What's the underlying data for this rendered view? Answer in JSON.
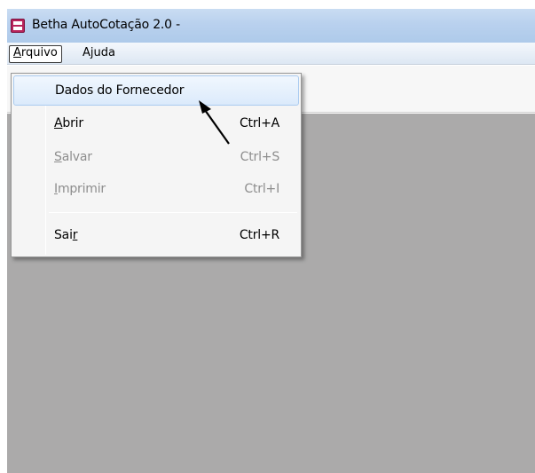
{
  "window": {
    "title": "Betha AutoCotação 2.0 -"
  },
  "menubar": {
    "arquivo": {
      "first": "A",
      "rest": "rquivo"
    },
    "ajuda": "Ajuda"
  },
  "dropdown": {
    "dados": {
      "label": "Dados do Fornecedor"
    },
    "abrir": {
      "first": "A",
      "rest": "brir",
      "shortcut": "Ctrl+A"
    },
    "salvar": {
      "first": "S",
      "rest": "alvar",
      "shortcut": "Ctrl+S"
    },
    "imprimir": {
      "first": "I",
      "rest": "mprimir",
      "shortcut": "Ctrl+I"
    },
    "sair": {
      "pre": "Sai",
      "mnemonic": "r",
      "shortcut": "Ctrl+R"
    }
  },
  "colors": {
    "titlebar": "#b9d1ee",
    "client_background": "#abaaaa",
    "menu_highlight": "#dbeafb",
    "disabled_text": "#8d8d8d"
  },
  "icons": {
    "app": "application-icon",
    "pointer": "arrow-pointer-icon"
  }
}
